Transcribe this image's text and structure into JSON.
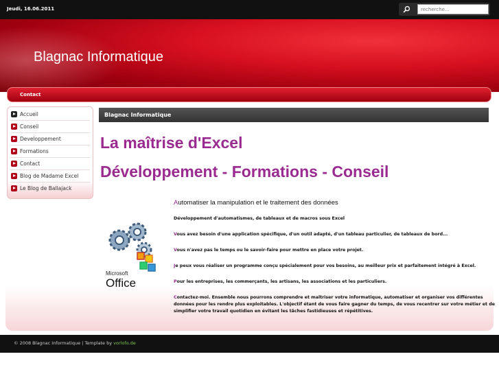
{
  "topbar": {
    "date": "Jeudi, 16.06.2011",
    "search_placeholder": "recherche..."
  },
  "header": {
    "site_title": "Blagnac Informatique"
  },
  "topnav": {
    "items": [
      {
        "label": "Contact"
      }
    ]
  },
  "sidebar": {
    "items": [
      {
        "label": "Accueil"
      },
      {
        "label": "Conseil"
      },
      {
        "label": "Developpement"
      },
      {
        "label": "Formations"
      },
      {
        "label": "Contact"
      },
      {
        "label": "Blog de Madame Excel"
      },
      {
        "label": "Le Blog de Ballajack"
      }
    ]
  },
  "main": {
    "bar_title": "Blagnac Informatique",
    "heading1": "La maîtrise d'Excel",
    "heading2": "Développement - Formations - Conseil",
    "image": {
      "line1": "Microsoft",
      "line2": "Office"
    },
    "intro_first": "A",
    "intro_rest": "utomatiser la manipulation et le traitement des données",
    "p1": "Développement d'automatismes, de tableaux et de macros sous Excel",
    "p2_first": "V",
    "p2_rest": "ous avez besoin d'une application spécifique, d'un outil adapté, d'un tableau particulier, de tableaux de bord...",
    "p3_first": "V",
    "p3_rest": "ous n'avez pas le temps ou le savoir-faire pour mettre en place votre projet.",
    "p4_first": "J",
    "p4_rest": "e peux vous réaliser un programme conçu spécialement pour vos besoins, au meilleur prix et parfaitement intégré à Excel.",
    "p5_first": "P",
    "p5_rest": "our les entreprises, les commerçants, les artisans, les associations et les particuliers.",
    "p6_first": "C",
    "p6_rest": "ontactez-moi. Ensemble nous pourrons comprendre et maîtriser votre informatique, automatiser et organiser vos différentes données pour les rendre plus exploitables. L'objectif étant de vous faire gagner du temps, de vous recentrer sur votre métier et de simplifier votre travail quotidien en évitant les tâches fastidieuses et répétitives."
  },
  "footer": {
    "text": "© 2008 Blagnac Informatique | Template by",
    "link": "vorlofo.de"
  },
  "colors": {
    "accent_red": "#d81020",
    "heading_purple": "#9a2a90",
    "dark_bar": "#111111"
  }
}
